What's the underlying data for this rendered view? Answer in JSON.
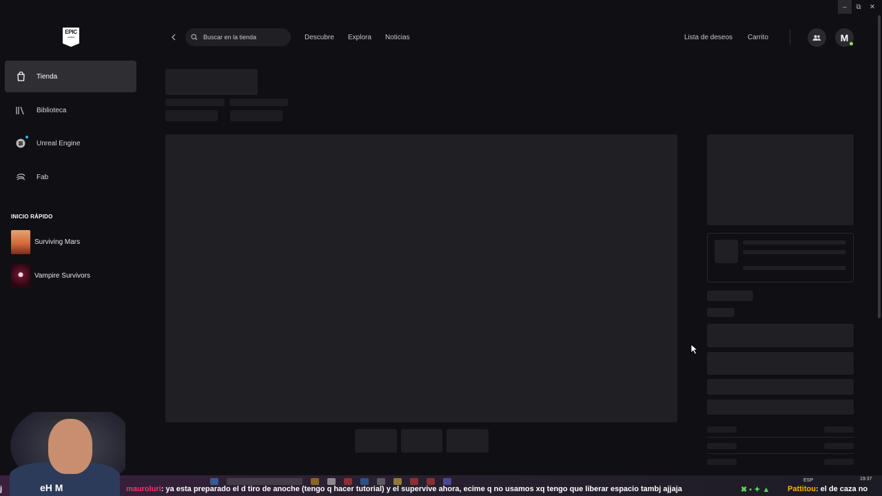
{
  "window": {
    "controls": {
      "minimize": "–",
      "maximize": "⧉",
      "close": "✕"
    }
  },
  "logo": {
    "line1": "EPIC",
    "line2": "GAMES"
  },
  "sidebar": {
    "items": [
      {
        "label": "Tienda",
        "icon": "bag-icon",
        "active": true
      },
      {
        "label": "Biblioteca",
        "icon": "library-icon",
        "active": false
      },
      {
        "label": "Unreal Engine",
        "icon": "unreal-icon",
        "active": false,
        "notification": true
      },
      {
        "label": "Fab",
        "icon": "fab-icon",
        "active": false
      }
    ],
    "quick_start_title": "INICIO RÁPIDO",
    "quick_start": [
      {
        "label": "Surviving Mars"
      },
      {
        "label": "Vampire Survivors"
      }
    ]
  },
  "topbar": {
    "search_placeholder": "Buscar en la tienda",
    "nav": [
      "Descubre",
      "Explora",
      "Noticias"
    ],
    "wishlist": "Lista de deseos",
    "cart": "Carrito",
    "avatar_initial": "M"
  },
  "stream_overlay": {
    "shirt_text": "eH      M",
    "chat_prefix": "j",
    "user1": "mauroluri",
    "message1": ": ya esta preparado el d tiro de anoche (tengo q hacer tutorial) y el supervive  ahora, ecime q no usamos xq tengo que liberar espacio tambj ajjaja",
    "user2": "Pattitou",
    "message2": ": el de caza no",
    "lang": "ESP",
    "clock": "19:37"
  },
  "colors": {
    "background": "#101014",
    "active_nav": "#2f2f33",
    "skeleton": "#1d1d21",
    "accent_blue": "#26bbff",
    "online_green": "#8fe356"
  }
}
